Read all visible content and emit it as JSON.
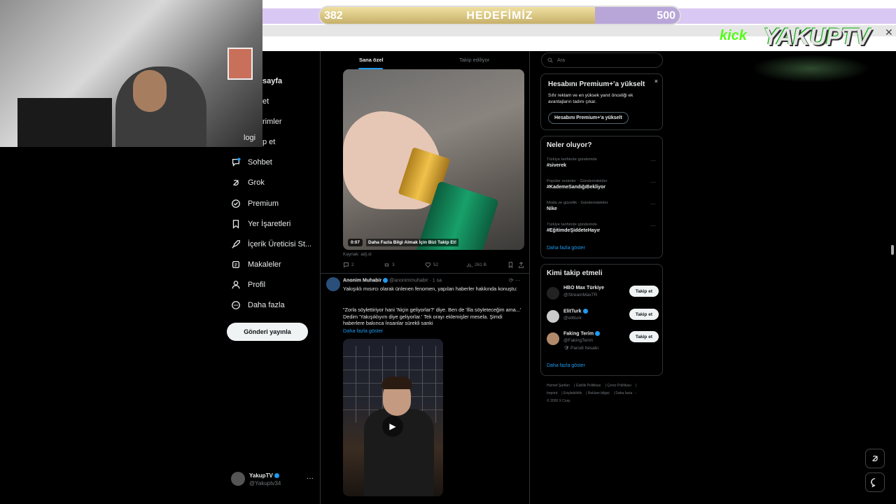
{
  "stream": {
    "goal": {
      "label": "HEDEFİMİZ",
      "current": "382",
      "target": "500",
      "progress": 0.764
    },
    "logo": {
      "kick": "kick",
      "name": "YAKUPTV"
    },
    "webcam_text": "logi"
  },
  "sidebar": {
    "partial_items": [
      {
        "name": "home",
        "text": "sayfa"
      },
      {
        "name": "explore",
        "text": "et"
      },
      {
        "name": "notifications",
        "text": "rimler"
      },
      {
        "name": "follow",
        "text": "p et"
      }
    ],
    "items": [
      {
        "label": "Sohbet",
        "icon": "chat-icon"
      },
      {
        "label": "Grok",
        "icon": "grok-icon"
      },
      {
        "label": "Premium",
        "icon": "premium-icon"
      },
      {
        "label": "Yer İşaretleri",
        "icon": "bookmark-icon"
      },
      {
        "label": "İçerik Üreticisi St...",
        "icon": "rocket-icon"
      },
      {
        "label": "Makaleler",
        "icon": "article-icon"
      },
      {
        "label": "Profil",
        "icon": "profile-icon"
      },
      {
        "label": "Daha fazla",
        "icon": "more-circle-icon"
      }
    ],
    "post_button": "Gönderi yayınla",
    "account": {
      "name": "YakupTV",
      "handle": "@Yakuptv34",
      "more": "···"
    }
  },
  "feed": {
    "tabs": [
      "Sana özel",
      "Takip ediliyor"
    ],
    "tweet1": {
      "video_time": "0:07",
      "video_caption": "Daha Fazla Bilgi Almak İçin Bizi Takip Et!",
      "source": "Kaynak: adj.st",
      "replies": "2",
      "retweets": "3",
      "likes": "52",
      "views": "261 B"
    },
    "tweet2": {
      "author": "Anonim Muhabir",
      "meta": "@anonimmuhabir · 1 sa",
      "text1": "Yakışıklı mısırcı olarak ünlenen fenomen, yapılan haberler hakkında konuştu:",
      "text2": "\"Zorla söylettiriyor hani 'Niçin geliyorlar?' diye. Ben de 'İlla söyleteceğim ama...' Dedim 'Yakışıklıyım diye geliyorlar.' Tek orayı eklemişler mesela. Şimdi haberlere bakınca İnsanlar sürekli sanki",
      "more": "Daha fazla göster"
    }
  },
  "right": {
    "search_placeholder": "Ara",
    "premium": {
      "title": "Hesabını Premium+'a yükselt",
      "desc": "Sıfır reklam ve en yüksek yanıt önceliği ek avantajların tadını çıkar.",
      "button": "Hesabını Premium+'a yükselt",
      "close": "×"
    },
    "trends": {
      "title": "Neler oluyor?",
      "items": [
        {
          "context": "Türkiye tarihinde gündemde",
          "name": "#siverek"
        },
        {
          "context": "Popüler resimler · Gündemdekiler",
          "name": "#KademeSandığıBekliyor"
        },
        {
          "context": "Moda ve güzellik · Gündemdekiler",
          "name": "Nike"
        },
        {
          "context": "Türkiye tarihinde gündemde",
          "name": "#EğitimdeŞiddeteHayır"
        }
      ],
      "more": "Daha fazla göster"
    },
    "follow": {
      "title": "Kimi takip etmeli",
      "items": [
        {
          "name": "HBO Max Türkiye",
          "handle": "@StreamMaxTR",
          "button": "Takip et",
          "note": ""
        },
        {
          "name": "ElitTurk",
          "handle": "@elitturk",
          "button": "Takip et",
          "note": ""
        },
        {
          "name": "Faking Terim",
          "handle": "@FakingTerim",
          "button": "Takip et",
          "note": "Parodi hesabı"
        }
      ],
      "more": "Daha fazla göster"
    },
    "footer": {
      "line1": [
        "Hizmet Şartları",
        "Gizlilik Politikası",
        "Çerez Politikası"
      ],
      "line2": [
        "Imprint",
        "Erişilebilirlik",
        "Reklam bilgisi",
        "Daha fazla ···"
      ],
      "line3": "© 2026 X Corp."
    }
  }
}
